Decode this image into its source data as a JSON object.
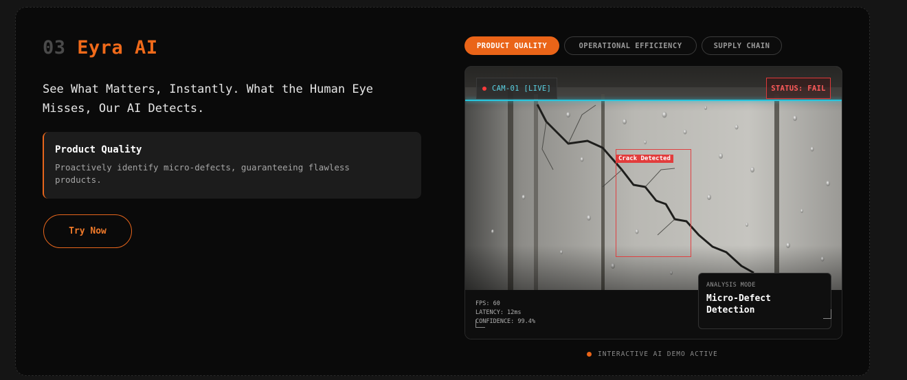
{
  "section": {
    "number": "03",
    "name": "Eyra AI",
    "tagline": "See What Matters, Instantly. What the Human Eye Misses, Our AI Detects."
  },
  "feature": {
    "title": "Product Quality",
    "description": "Proactively identify micro-defects, guaranteeing flawless products."
  },
  "cta": {
    "label": "Try Now"
  },
  "tabs": [
    {
      "label": "PRODUCT QUALITY",
      "active": true
    },
    {
      "label": "OPERATIONAL EFFICIENCY",
      "active": false
    },
    {
      "label": "SUPPLY CHAIN",
      "active": false
    }
  ],
  "viewer": {
    "camera_label": "CAM-01 [LIVE]",
    "status_label": "STATUS: FAIL",
    "detection_label": "Crack Detected",
    "stats": {
      "fps": "FPS: 60",
      "latency": "LATENCY: 12ms",
      "confidence": "CONFIDENCE: 99.4%"
    },
    "analysis_mode": {
      "label": "ANALYSIS MODE",
      "value_line1": "Micro-Defect",
      "value_line2": "Detection"
    }
  },
  "demo_status": "INTERACTIVE AI DEMO ACTIVE",
  "colors": {
    "accent": "#ea6418",
    "cyan": "#27c6de",
    "alert": "#e23c3c",
    "panel": "#0a0a0a"
  },
  "icons": {
    "live_dot": "red-dot-icon",
    "demo_dot": "orange-dot-icon"
  }
}
